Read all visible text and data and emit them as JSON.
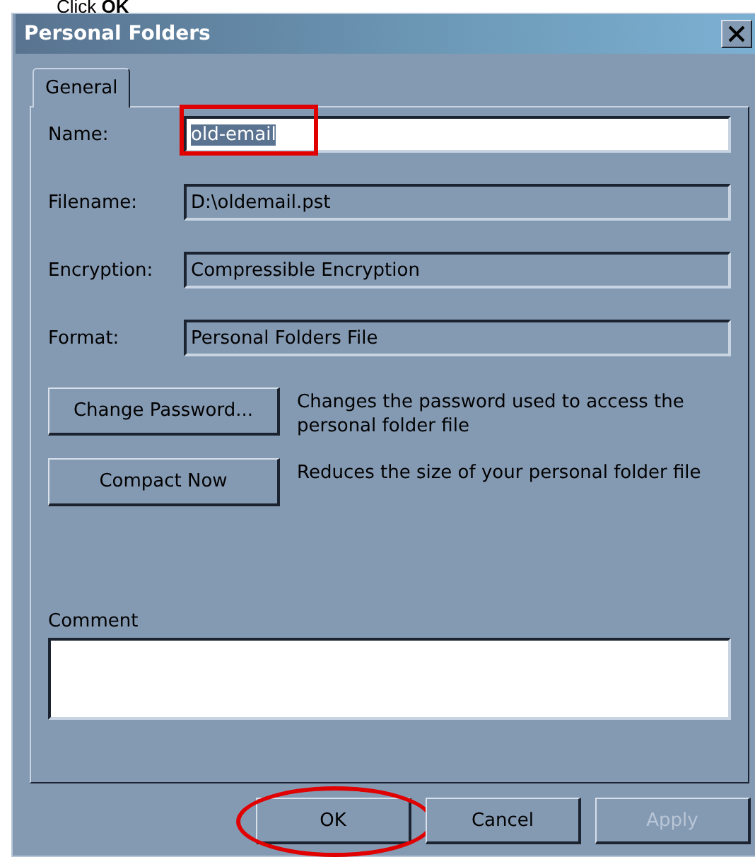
{
  "caption": "Click **OK**",
  "window": {
    "title": "Personal Folders"
  },
  "tabs": [
    {
      "label": "General",
      "selected": true
    }
  ],
  "fields": [
    {
      "label": "Name:",
      "value": "old-email",
      "disabled": false,
      "selected_text": true,
      "highlighted": true
    },
    {
      "label": "Filename:",
      "value": "D:\\oldemail.pst",
      "disabled": true,
      "selected_text": false,
      "highlighted": false
    },
    {
      "label": "Encryption:",
      "value": "Compressible Encryption",
      "disabled": true,
      "selected_text": false,
      "highlighted": false
    },
    {
      "label": "Format:",
      "value": "Personal Folders File",
      "disabled": true,
      "selected_text": false,
      "highlighted": false
    }
  ],
  "actions": [
    {
      "label": "Change Password...",
      "description": "Changes the password used to access the personal folder file"
    },
    {
      "label": "Compact Now",
      "description": "Reduces the size of your personal folder file"
    }
  ],
  "comment": {
    "label": "Comment"
  },
  "buttons": [
    {
      "label": "OK",
      "disabled": false,
      "highlighted": true
    },
    {
      "label": "Cancel",
      "disabled": false,
      "highlighted": false
    },
    {
      "label": "Apply",
      "disabled": true,
      "highlighted": false
    }
  ]
}
